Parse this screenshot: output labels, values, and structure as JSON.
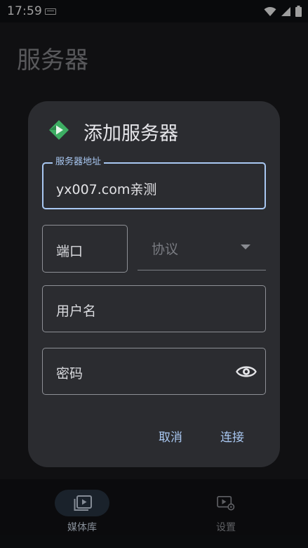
{
  "status_bar": {
    "time": "17:59"
  },
  "page": {
    "title": "服务器"
  },
  "dialog": {
    "title": "添加服务器",
    "server_address": {
      "label": "服务器地址",
      "value": "yx007.com亲测"
    },
    "port": {
      "label": "端口"
    },
    "protocol": {
      "label": "协议"
    },
    "username": {
      "label": "用户名"
    },
    "password": {
      "label": "密码"
    },
    "cancel_label": "取消",
    "connect_label": "连接"
  },
  "bottom_nav": {
    "items": [
      {
        "label": "媒体库",
        "active": true
      },
      {
        "label": "设置",
        "active": false
      }
    ]
  },
  "colors": {
    "accent": "#a9c8f2",
    "dialog_bg": "#2b2c30",
    "app_icon": "#3dae63"
  }
}
